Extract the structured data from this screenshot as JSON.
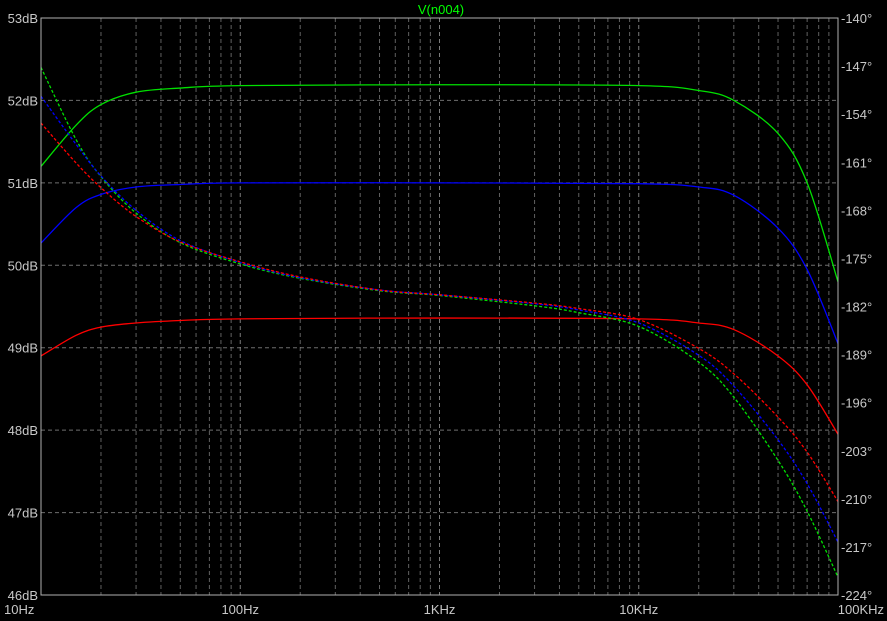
{
  "chart_data": {
    "type": "line",
    "title": "V(n004)",
    "title_color": "#00ff00",
    "x_scale": "log",
    "xlim_hz": [
      10,
      100000
    ],
    "x_ticks": [
      {
        "value": 10,
        "label": "10Hz"
      },
      {
        "value": 100,
        "label": "100Hz"
      },
      {
        "value": 1000,
        "label": "1KHz"
      },
      {
        "value": 10000,
        "label": "10KHz"
      },
      {
        "value": 100000,
        "label": "100KHz"
      }
    ],
    "ylim_db": [
      46,
      53
    ],
    "y_left_ticks": [
      {
        "value": 53,
        "label": "53dB"
      },
      {
        "value": 52,
        "label": "52dB"
      },
      {
        "value": 51,
        "label": "51dB"
      },
      {
        "value": 50,
        "label": "50dB"
      },
      {
        "value": 49,
        "label": "49dB"
      },
      {
        "value": 48,
        "label": "48dB"
      },
      {
        "value": 47,
        "label": "47dB"
      },
      {
        "value": 46,
        "label": "46dB"
      }
    ],
    "ylim_deg": [
      -224,
      -140
    ],
    "y_right_ticks": [
      {
        "value": -140,
        "label": "-140°"
      },
      {
        "value": -147,
        "label": "-147°"
      },
      {
        "value": -154,
        "label": "-154°"
      },
      {
        "value": -161,
        "label": "-161°"
      },
      {
        "value": -168,
        "label": "-168°"
      },
      {
        "value": -175,
        "label": "-175°"
      },
      {
        "value": -182,
        "label": "-182°"
      },
      {
        "value": -189,
        "label": "-189°"
      },
      {
        "value": -196,
        "label": "-196°"
      },
      {
        "value": -203,
        "label": "-203°"
      },
      {
        "value": -210,
        "label": "-210°"
      },
      {
        "value": -217,
        "label": "-217°"
      },
      {
        "value": -224,
        "label": "-224°"
      }
    ],
    "grid": true,
    "series": [
      {
        "kind": "magnitude",
        "color": "#00e000",
        "x": [
          10,
          15,
          20,
          30,
          50,
          100,
          1000,
          10000,
          20000,
          30000,
          50000,
          70000,
          100000
        ],
        "y_db": [
          51.2,
          51.7,
          51.95,
          52.1,
          52.15,
          52.18,
          52.19,
          52.18,
          52.12,
          52.0,
          51.6,
          51.0,
          49.8
        ]
      },
      {
        "kind": "magnitude",
        "color": "#0000ff",
        "x": [
          10,
          15,
          20,
          30,
          50,
          100,
          1000,
          10000,
          20000,
          30000,
          50000,
          70000,
          100000
        ],
        "y_db": [
          50.27,
          50.7,
          50.86,
          50.95,
          50.98,
          51.0,
          51.0,
          50.99,
          50.95,
          50.85,
          50.45,
          49.95,
          49.05
        ]
      },
      {
        "kind": "magnitude",
        "color": "#ff0000",
        "x": [
          10,
          15,
          20,
          30,
          50,
          100,
          1000,
          10000,
          20000,
          30000,
          50000,
          70000,
          100000
        ],
        "y_db": [
          48.9,
          49.15,
          49.25,
          49.3,
          49.33,
          49.35,
          49.36,
          49.35,
          49.3,
          49.22,
          48.9,
          48.55,
          47.95
        ]
      },
      {
        "kind": "phase",
        "color": "#00e000",
        "dashed": true,
        "x": [
          10,
          15,
          20,
          30,
          50,
          100,
          200,
          500,
          1000,
          3000,
          5000,
          10000,
          20000,
          30000,
          50000,
          70000,
          100000
        ],
        "y_deg": [
          -147.2,
          -157.7,
          -163.1,
          -168.4,
          -172.7,
          -175.8,
          -177.9,
          -179.7,
          -180.4,
          -181.9,
          -182.9,
          -184.9,
          -190.1,
          -195.2,
          -204.4,
          -211.8,
          -221.4
        ]
      },
      {
        "kind": "phase",
        "color": "#0000ff",
        "dashed": true,
        "x": [
          10,
          15,
          20,
          30,
          50,
          100,
          200,
          500,
          1000,
          3000,
          5000,
          10000,
          20000,
          30000,
          50000,
          70000,
          100000
        ],
        "y_deg": [
          -151.4,
          -158.4,
          -163.0,
          -168.0,
          -172.4,
          -175.6,
          -177.8,
          -179.6,
          -180.3,
          -181.6,
          -182.5,
          -184.4,
          -189.1,
          -193.6,
          -201.4,
          -207.8,
          -216.3
        ]
      },
      {
        "kind": "phase",
        "color": "#ff0000",
        "dashed": true,
        "x": [
          10,
          15,
          20,
          30,
          50,
          100,
          200,
          500,
          1000,
          3000,
          5000,
          10000,
          20000,
          30000,
          50000,
          70000,
          100000
        ],
        "y_deg": [
          -155.3,
          -161.1,
          -164.7,
          -168.9,
          -172.6,
          -175.5,
          -177.7,
          -179.6,
          -180.3,
          -181.5,
          -182.3,
          -183.9,
          -188.1,
          -191.8,
          -198.1,
          -203.2,
          -210.4
        ]
      }
    ]
  }
}
